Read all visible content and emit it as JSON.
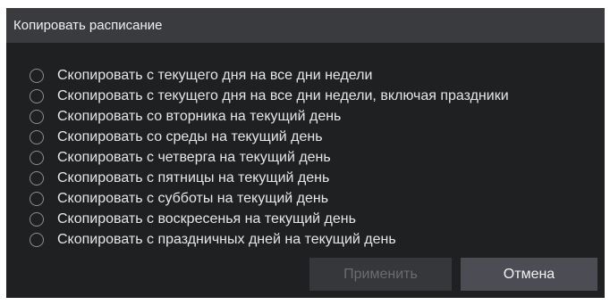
{
  "dialog": {
    "title": "Копировать расписание",
    "options": [
      {
        "label": "Скопировать с текущего дня на все дни недели",
        "checked": false
      },
      {
        "label": "Скопировать с текущего дня на все дни недели, включая праздники",
        "checked": false
      },
      {
        "label": "Скопировать со вторника на текущий день",
        "checked": false
      },
      {
        "label": "Скопировать со среды на текущий день",
        "checked": false
      },
      {
        "label": "Скопировать с четверга на текущий день",
        "checked": false
      },
      {
        "label": "Скопировать с пятницы на текущий день",
        "checked": false
      },
      {
        "label": "Скопировать с субботы на текущий день",
        "checked": false
      },
      {
        "label": "Скопировать с воскресенья на текущий день",
        "checked": false
      },
      {
        "label": "Скопировать с праздничных дней на текущий день",
        "checked": false
      }
    ],
    "buttons": {
      "apply_label": "Применить",
      "apply_enabled": false,
      "cancel_label": "Отмена"
    }
  },
  "colors": {
    "dialog_bg": "#1f2021",
    "titlebar_bg": "#3a3b3e",
    "text": "#e6e6e6",
    "radio_border": "#8c8d90",
    "apply_bg_disabled": "#36373b",
    "apply_text_disabled": "#6b6c70",
    "cancel_bg": "#4c4d54"
  }
}
